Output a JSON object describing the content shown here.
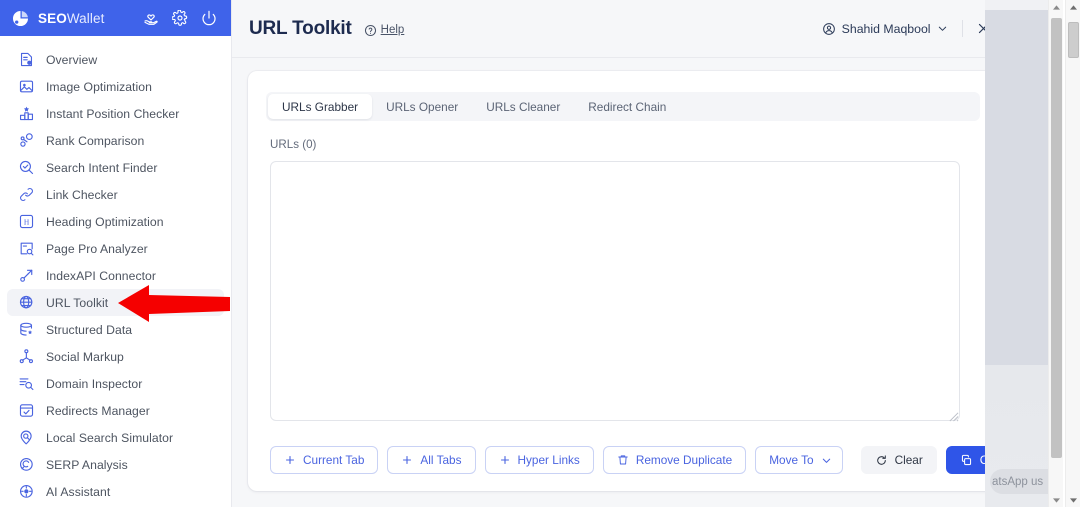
{
  "brand": {
    "name_bold": "SEO",
    "name_light": "Wallet",
    "logo_icon": "pie-chart-icon",
    "header_icons": [
      {
        "name": "heart-hand-icon",
        "label": "Support"
      },
      {
        "name": "gear-icon",
        "label": "Settings"
      },
      {
        "name": "power-icon",
        "label": "Logout"
      }
    ]
  },
  "sidebar": {
    "items": [
      {
        "label": "Overview",
        "icon": "report-icon",
        "active": false
      },
      {
        "label": "Image Optimization",
        "icon": "image-icon",
        "active": false
      },
      {
        "label": "Instant Position Checker",
        "icon": "podium-icon",
        "active": false
      },
      {
        "label": "Rank Comparison",
        "icon": "nodes-icon",
        "active": false
      },
      {
        "label": "Search Intent Finder",
        "icon": "search-check-icon",
        "active": false
      },
      {
        "label": "Link Checker",
        "icon": "link-icon",
        "active": false
      },
      {
        "label": "Heading Optimization",
        "icon": "heading-h-icon",
        "active": false
      },
      {
        "label": "Page Pro Analyzer",
        "icon": "page-search-icon",
        "active": false
      },
      {
        "label": "IndexAPI Connector",
        "icon": "api-link-icon",
        "active": false
      },
      {
        "label": "URL Toolkit",
        "icon": "globe-icon",
        "active": true
      },
      {
        "label": "Structured Data",
        "icon": "database-star-icon",
        "active": false
      },
      {
        "label": "Social Markup",
        "icon": "share-icon",
        "active": false
      },
      {
        "label": "Domain Inspector",
        "icon": "domain-search-icon",
        "active": false
      },
      {
        "label": "Redirects Manager",
        "icon": "redirect-window-icon",
        "active": false
      },
      {
        "label": "Local Search Simulator",
        "icon": "map-pin-search-icon",
        "active": false
      },
      {
        "label": "SERP Analysis",
        "icon": "serp-circle-icon",
        "active": false
      },
      {
        "label": "AI Assistant",
        "icon": "ai-gear-icon",
        "active": false
      }
    ]
  },
  "header": {
    "title": "URL Toolkit",
    "help_label": "Help",
    "help_icon": "question-circle-icon",
    "user": {
      "name": "Shahid Maqbool",
      "avatar_icon": "user-circle-icon",
      "chevron_icon": "chevron-down-icon"
    },
    "close": {
      "label": "Close",
      "icon": "close-x-icon"
    }
  },
  "card": {
    "tabs": [
      {
        "label": "URLs Grabber",
        "active": true
      },
      {
        "label": "URLs Opener",
        "active": false
      },
      {
        "label": "URLs Cleaner",
        "active": false
      },
      {
        "label": "Redirect Chain",
        "active": false
      }
    ],
    "urls_field": {
      "label": "URLs (0)",
      "value": "",
      "placeholder": ""
    },
    "buttons": [
      {
        "label": "Current Tab",
        "icon": "plus-icon",
        "style": "outline"
      },
      {
        "label": "All Tabs",
        "icon": "plus-icon",
        "style": "outline"
      },
      {
        "label": "Hyper Links",
        "icon": "plus-icon",
        "style": "outline"
      },
      {
        "label": "Remove Duplicate",
        "icon": "trash-icon",
        "style": "outline"
      },
      {
        "label": "Move To",
        "icon": "chevron-down-icon",
        "style": "outline"
      },
      {
        "label": "Clear",
        "icon": "reset-icon",
        "style": "plain"
      },
      {
        "label": "Copy",
        "icon": "copy-icon",
        "style": "primary"
      }
    ]
  },
  "overlay": {
    "arrow": {
      "name": "red-pointer-arrow",
      "color": "#f50000",
      "points_to": "URL Toolkit"
    }
  },
  "widget": {
    "whatsapp_label": "atsApp us"
  },
  "colors": {
    "brand_blue": "#3f63ea",
    "primary_button": "#2f55e8",
    "outline_button_text": "#4a64e0",
    "page_bg": "#f6f7f9",
    "title": "#1d2b4f",
    "arrow_red": "#f50000"
  }
}
